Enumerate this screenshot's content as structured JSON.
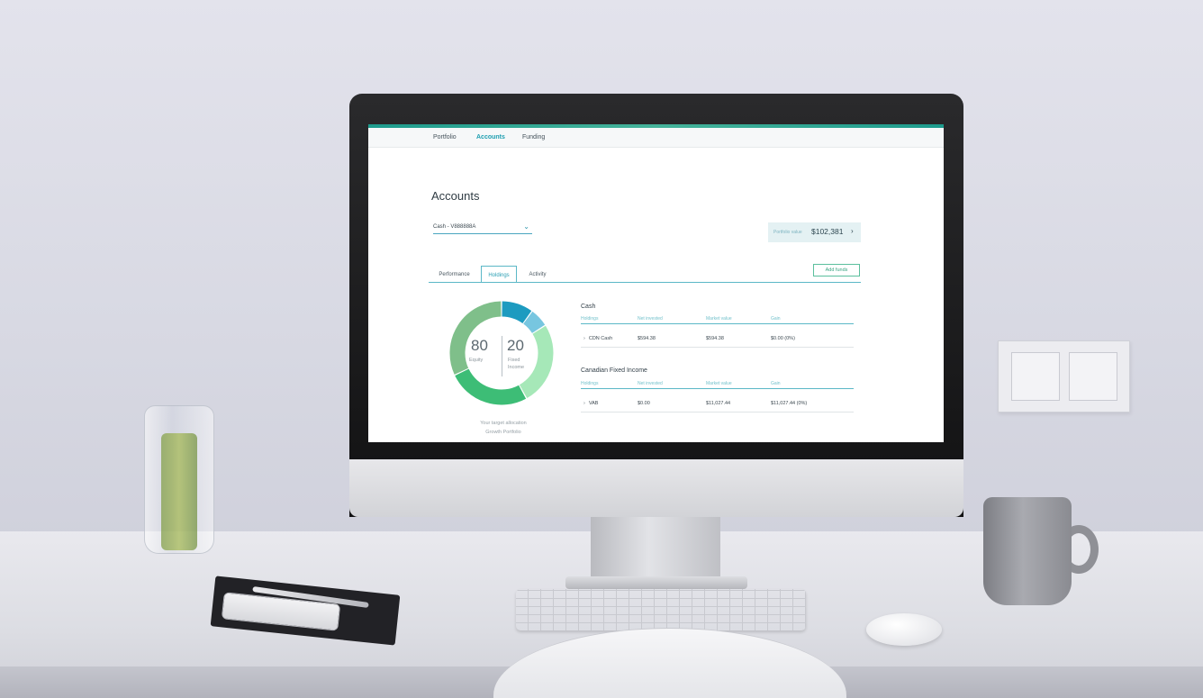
{
  "nav": {
    "items": [
      "Portfolio",
      "Accounts",
      "Funding"
    ],
    "active": "Accounts"
  },
  "page": {
    "title": "Accounts"
  },
  "account_select": {
    "value": "Cash - V888888A"
  },
  "portfolio_value": {
    "label": "Portfolio value",
    "amount": "$102,381",
    "chevron": "›"
  },
  "tabs": [
    "Performance",
    "Holdings",
    "Activity"
  ],
  "active_tab": "Holdings",
  "add_funds_label": "Add funds",
  "allocation": {
    "equity_value": "80",
    "equity_label": "Equity",
    "fixed_value": "20",
    "fixed_label_line1": "Fixed",
    "fixed_label_line2": "Income",
    "caption_line1": "Your target allocation",
    "caption_line2": "Growth Portfolio",
    "segments": [
      {
        "share": 0.1,
        "color": "#1d9bc0"
      },
      {
        "share": 0.06,
        "color": "#77c6e0"
      },
      {
        "share": 0.26,
        "color": "#a6e8b8"
      },
      {
        "share": 0.26,
        "color": "#3dbd76"
      },
      {
        "share": 0.32,
        "color": "#7fbf8a"
      }
    ]
  },
  "holdings": {
    "columns": [
      "Holdings",
      "Net invested",
      "Market value",
      "Gain"
    ],
    "groups": [
      {
        "title": "Cash",
        "rows": [
          {
            "name": "CDN Cash",
            "net_invested": "$594.38",
            "market_value": "$594.38",
            "gain": "$0.00 (0%)"
          }
        ]
      },
      {
        "title": "Canadian Fixed Income",
        "rows": [
          {
            "name": "VAB",
            "net_invested": "$0.00",
            "market_value": "$11,027.44",
            "gain": "$11,027.44 (0%)"
          }
        ]
      }
    ]
  },
  "icons": {
    "dropdown": "chevron-down-icon",
    "row_expand": "chevron-right-icon"
  },
  "colors": {
    "accent": "#1f9fb1",
    "accent_green": "#3aa582"
  }
}
